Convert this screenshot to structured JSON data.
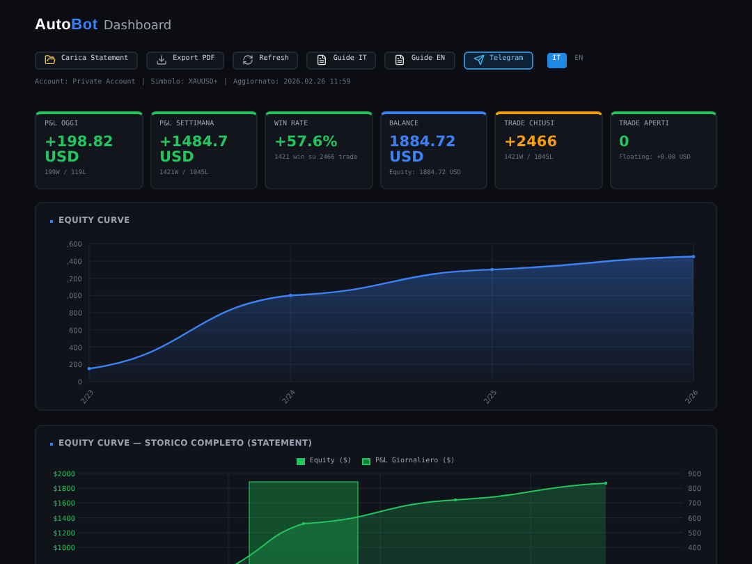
{
  "header": {
    "brand_a": "Auto",
    "brand_b": "Bot",
    "title": "Dashboard"
  },
  "toolbar": [
    {
      "kind": "folder",
      "label": "Carica Statement",
      "selected": false
    },
    {
      "kind": "download",
      "label": "Export PDF",
      "selected": false
    },
    {
      "kind": "refresh",
      "label": "Refresh",
      "selected": false
    },
    {
      "kind": "file",
      "label": "Guide IT",
      "selected": false
    },
    {
      "kind": "file",
      "label": "Guide EN",
      "selected": false
    },
    {
      "kind": "telegram",
      "label": "Telegram",
      "selected": true
    }
  ],
  "languages": [
    {
      "label": "IT",
      "selected": true
    },
    {
      "label": "EN",
      "selected": false
    }
  ],
  "info": [
    "Account: Private Account",
    "|",
    "Simbolo: XAUUSD+",
    "|",
    "Aggiornato: 2026.02.26 11:59"
  ],
  "cards": [
    {
      "label": "P&L OGGI",
      "value": "+198.82 USD",
      "sub": "199W / 119L",
      "color": "#22c55e"
    },
    {
      "label": "P&L SETTIMANA",
      "value": "+1484.7 USD",
      "sub": "1421W / 1045L",
      "color": "#22c55e"
    },
    {
      "label": "WIN RATE",
      "value": "+57.6%",
      "sub": "1421 win su 2466 trade",
      "color": "#22c55e"
    },
    {
      "label": "BALANCE",
      "value": "1884.72 USD",
      "sub": "Equity: 1884.72 USD",
      "color": "#3b82f6"
    },
    {
      "label": "TRADE CHIUSI",
      "value": "+2466",
      "sub": "1421W / 1045L",
      "color": "#f59e0b"
    },
    {
      "label": "TRADE APERTI",
      "value": "0",
      "sub": "Floating: +0.00 USD",
      "color": "#22c55e"
    }
  ],
  "equity": {
    "title": "EQUITY CURVE",
    "chart_data": {
      "type": "area",
      "categories": [
        "2/23",
        "2/24",
        "2/25",
        "2/26"
      ],
      "series": [
        {
          "color": "#3b82f6",
          "values": [
            150,
            1000,
            1300,
            1450
          ]
        }
      ],
      "ylim": [
        0,
        1600
      ],
      "yticks": [
        0,
        200,
        400,
        600,
        800
      ],
      "grid": true
    },
    "cut_axis_labels": [
      ",600",
      ",400",
      ",200",
      ",000"
    ]
  },
  "statement": {
    "title": "EQUITY CURVE — STORICO COMPLETO (STATEMENT)",
    "legend": [
      {
        "label": "Equity ($)",
        "color": "#22c55e"
      },
      {
        "label": "P&L Giornaliero ($)",
        "color": "#15803d"
      }
    ],
    "left_axis": [
      "$2000",
      "$1800",
      "$1600",
      "$1400",
      "$1200",
      "$1000"
    ],
    "right_axis": [
      "900",
      "800",
      "700",
      "600",
      "500",
      "400"
    ]
  }
}
